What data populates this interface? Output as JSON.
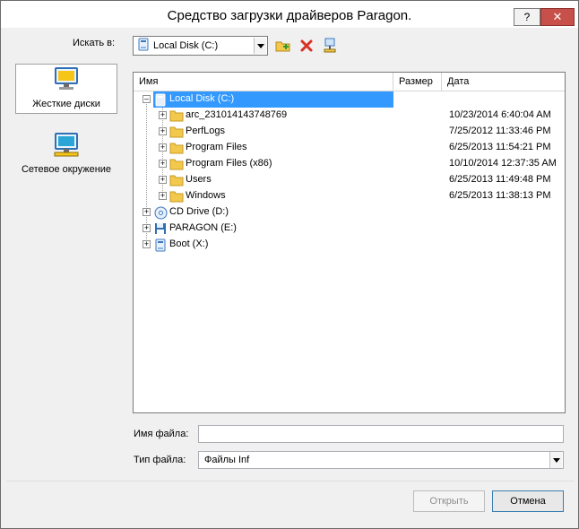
{
  "window": {
    "title": "Средство загрузки драйверов Paragon.",
    "help_label": "?",
    "close_label": "✕"
  },
  "toolbar": {
    "lookin_label": "Искать в:",
    "lookin_value": "Local Disk (C:)"
  },
  "places": [
    {
      "label": "Жесткие диски",
      "icon": "hard-drives-icon",
      "selected": true
    },
    {
      "label": "Сетевое окружение",
      "icon": "network-icon",
      "selected": false
    }
  ],
  "tree": {
    "columns": [
      "Имя",
      "Размер",
      "Дата"
    ],
    "rows": [
      {
        "name": "Local Disk (C:)",
        "date": "",
        "icon": "drive-icon"
      },
      {
        "name": "arc_231014143748769",
        "date": "10/23/2014 6:40:04 AM",
        "icon": "folder-icon"
      },
      {
        "name": "PerfLogs",
        "date": "7/25/2012 11:33:46 PM",
        "icon": "folder-icon"
      },
      {
        "name": "Program Files",
        "date": "6/25/2013 11:54:21 PM",
        "icon": "folder-icon"
      },
      {
        "name": "Program Files (x86)",
        "date": "10/10/2014 12:37:35 AM",
        "icon": "folder-icon"
      },
      {
        "name": "Users",
        "date": "6/25/2013 11:49:48 PM",
        "icon": "folder-icon"
      },
      {
        "name": "Windows",
        "date": "6/25/2013 11:38:13 PM",
        "icon": "folder-icon"
      },
      {
        "name": "CD Drive (D:)",
        "date": "",
        "icon": "cd-drive-icon"
      },
      {
        "name": "PARAGON (E:)",
        "date": "",
        "icon": "floppy-icon"
      },
      {
        "name": "Boot (X:)",
        "date": "",
        "icon": "drive-icon"
      }
    ]
  },
  "form": {
    "filename_label": "Имя файла:",
    "filename_value": "",
    "filetype_label": "Тип файла:",
    "filetype_value": "Файлы Inf"
  },
  "buttons": {
    "open": "Открыть",
    "cancel": "Отмена"
  }
}
